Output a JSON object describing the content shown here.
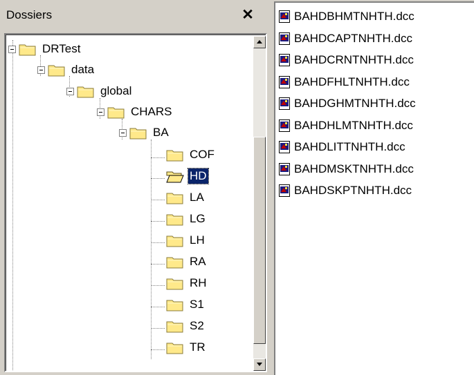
{
  "panel": {
    "title": "Dossiers",
    "close_glyph": "✕"
  },
  "tree": {
    "items": [
      {
        "label": "DRTest",
        "expanded": true,
        "open": false,
        "selected": false
      },
      {
        "label": "data",
        "expanded": true,
        "open": false,
        "selected": false
      },
      {
        "label": "global",
        "expanded": true,
        "open": false,
        "selected": false
      },
      {
        "label": "CHARS",
        "expanded": true,
        "open": false,
        "selected": false
      },
      {
        "label": "BA",
        "expanded": true,
        "open": false,
        "selected": false
      },
      {
        "label": "COF",
        "expanded": false,
        "open": false,
        "selected": false
      },
      {
        "label": "HD",
        "expanded": false,
        "open": true,
        "selected": true
      },
      {
        "label": "LA",
        "expanded": false,
        "open": false,
        "selected": false
      },
      {
        "label": "LG",
        "expanded": false,
        "open": false,
        "selected": false
      },
      {
        "label": "LH",
        "expanded": false,
        "open": false,
        "selected": false
      },
      {
        "label": "RA",
        "expanded": false,
        "open": false,
        "selected": false
      },
      {
        "label": "RH",
        "expanded": false,
        "open": false,
        "selected": false
      },
      {
        "label": "S1",
        "expanded": false,
        "open": false,
        "selected": false
      },
      {
        "label": "S2",
        "expanded": false,
        "open": false,
        "selected": false
      },
      {
        "label": "TR",
        "expanded": false,
        "open": false,
        "selected": false
      }
    ]
  },
  "files": {
    "items": [
      {
        "name": "BAHDBHMTNHTH.dcc"
      },
      {
        "name": "BAHDCAPTNHTH.dcc"
      },
      {
        "name": "BAHDCRNTNHTH.dcc"
      },
      {
        "name": "BAHDFHLTNHTH.dcc"
      },
      {
        "name": "BAHDGHMTNHTH.dcc"
      },
      {
        "name": "BAHDHLMTNHTH.dcc"
      },
      {
        "name": "BAHDLITTNHTH.dcc"
      },
      {
        "name": "BAHDMSKTNHTH.dcc"
      },
      {
        "name": "BAHDSKPTNHTH.dcc"
      }
    ]
  },
  "colors": {
    "selection": "#0a246a",
    "folder": "#ffe98a",
    "chrome": "#d4d0c8"
  }
}
